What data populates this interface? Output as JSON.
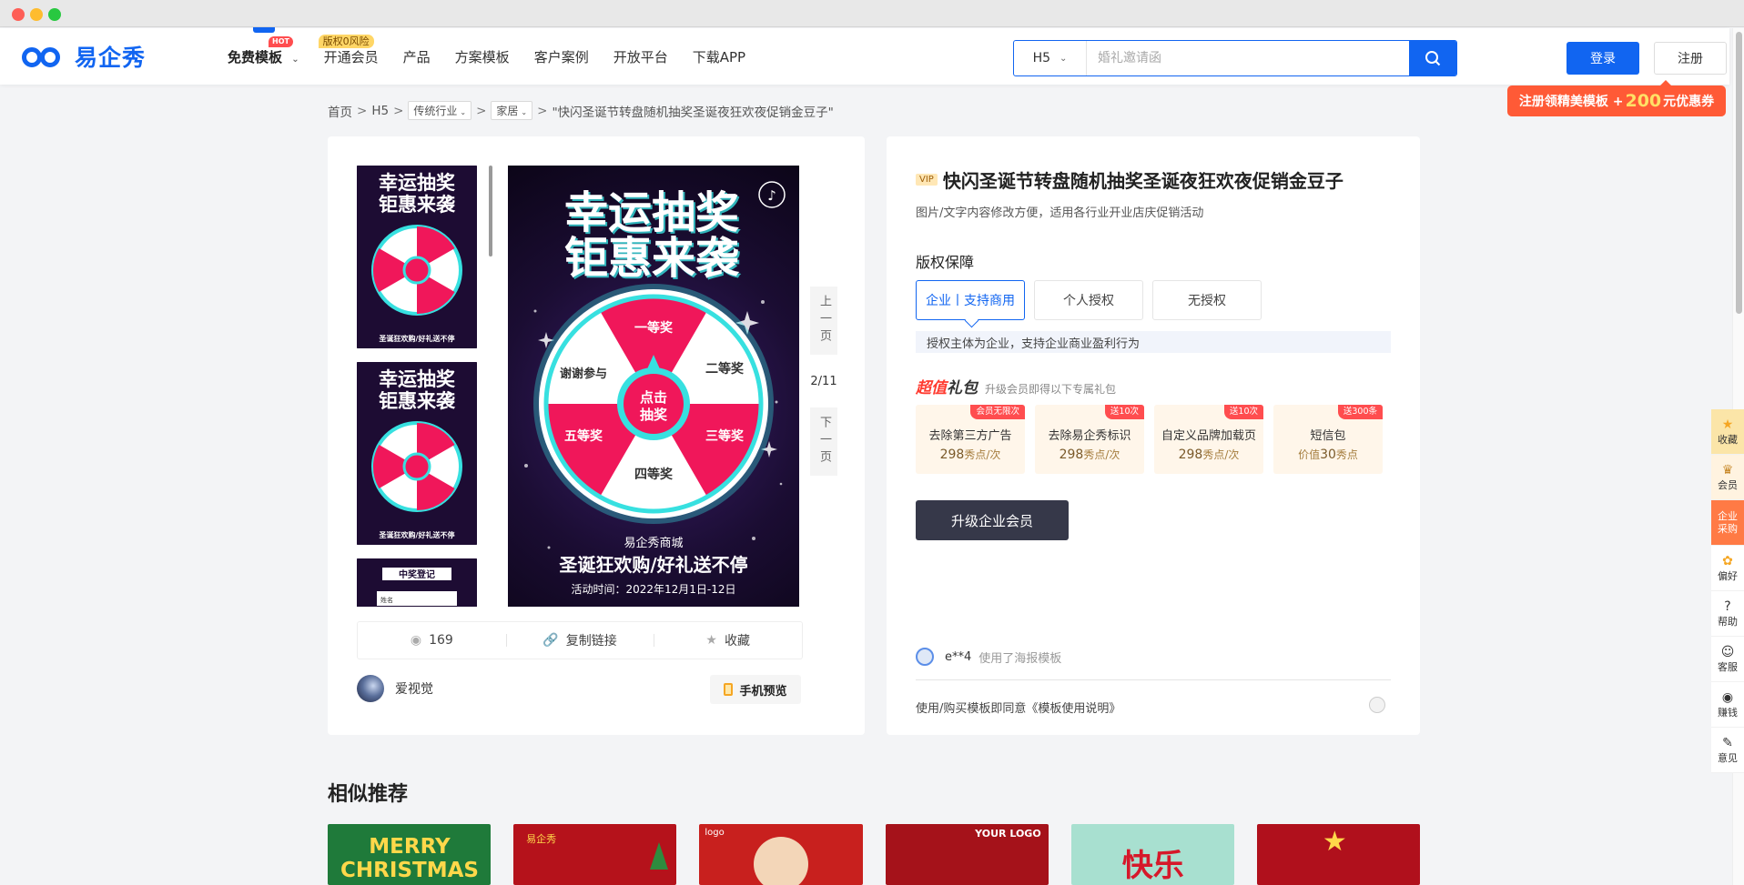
{
  "header": {
    "logo_text": "易企秀",
    "nav": [
      {
        "label": "免费模板",
        "badge": "HOT"
      },
      {
        "label": "开通会员",
        "badge": "版权0风险"
      },
      {
        "label": "产品"
      },
      {
        "label": "方案模板"
      },
      {
        "label": "客户案例"
      },
      {
        "label": "开放平台"
      },
      {
        "label": "下载APP"
      }
    ],
    "search": {
      "type": "H5",
      "placeholder": "婚礼邀请函"
    },
    "login": "登录",
    "register": "注册",
    "promo": {
      "pre": "注册领精美模板 +",
      "num": "200",
      "post": "元优惠券"
    }
  },
  "breadcrumb": {
    "home": "首页",
    "h5": "H5",
    "industry": "传统行业",
    "category": "家居",
    "current": "\"快闪圣诞节转盘随机抽奖圣诞夜狂欢夜促销金豆子\""
  },
  "poster": {
    "headline1": "幸运抽奖",
    "headline2": "钜惠来袭",
    "center": "点击抽奖",
    "prizes": [
      "一等奖",
      "二等奖",
      "三等奖",
      "四等奖",
      "五等奖",
      "谢谢参与"
    ],
    "shop": "易企秀商城",
    "slogan": "圣诞狂欢购/好礼送不停",
    "time": "活动时间：2022年12月1日-12日"
  },
  "thumb3": {
    "title": "中奖登记",
    "field": "姓名"
  },
  "page_ctrl": {
    "prev": "上一页",
    "page": "2/11",
    "next": "下一页"
  },
  "stats": {
    "views": "169",
    "copy": "复制链接",
    "fav": "收藏"
  },
  "author": {
    "name": "爱视觉",
    "mobile_preview": "手机预览"
  },
  "detail": {
    "vip": "VIP",
    "title": "快闪圣诞节转盘随机抽奖圣诞夜狂欢夜促销金豆子",
    "subtitle": "图片/文字内容修改方便，适用各行业开业店庆促销活动",
    "license_heading": "版权保障",
    "licenses": [
      "企业丨支持商用",
      "个人授权",
      "无授权"
    ],
    "license_desc": "授权主体为企业，支持企业商业盈利行为",
    "gift_title_a": "超值",
    "gift_title_b": "礼包",
    "gift_sub": "升级会员即得以下专属礼包",
    "gifts": [
      {
        "corner": "会员无限次",
        "name": "去除第三方广告",
        "pre": "",
        "value": "298",
        "unit": "秀点/次"
      },
      {
        "corner": "送10次",
        "name": "去除易企秀标识",
        "pre": "",
        "value": "298",
        "unit": "秀点/次"
      },
      {
        "corner": "送10次",
        "name": "自定义品牌加载页",
        "pre": "",
        "value": "298",
        "unit": "秀点/次"
      },
      {
        "corner": "送300条",
        "name": "短信包",
        "pre": "价值",
        "value": "30",
        "unit": "秀点"
      }
    ],
    "upgrade": "升级企业会员",
    "used_user": "e**4",
    "used_text": "使用了海报模板",
    "agree": "使用/购买模板即同意《模板使用说明》"
  },
  "tools": [
    {
      "icon": "★",
      "label": "收藏"
    },
    {
      "icon": "♛",
      "label": "会员"
    },
    {
      "label": "企业",
      "label2": "采购"
    },
    {
      "icon": "✿",
      "label": "偏好"
    },
    {
      "icon": "?",
      "label": "帮助"
    },
    {
      "icon": "☺",
      "label": "客服"
    },
    {
      "icon": "◉",
      "label": "赚钱"
    },
    {
      "icon": "✎",
      "label": "意见"
    }
  ],
  "similar": {
    "heading": "相似推荐",
    "items": [
      {
        "text": "MERRY CHRISTMAS"
      },
      {
        "text": "易企秀"
      },
      {
        "text": "logo"
      },
      {
        "text": "YOUR LOGO"
      },
      {
        "text": "快乐"
      },
      {
        "text": ""
      }
    ]
  }
}
